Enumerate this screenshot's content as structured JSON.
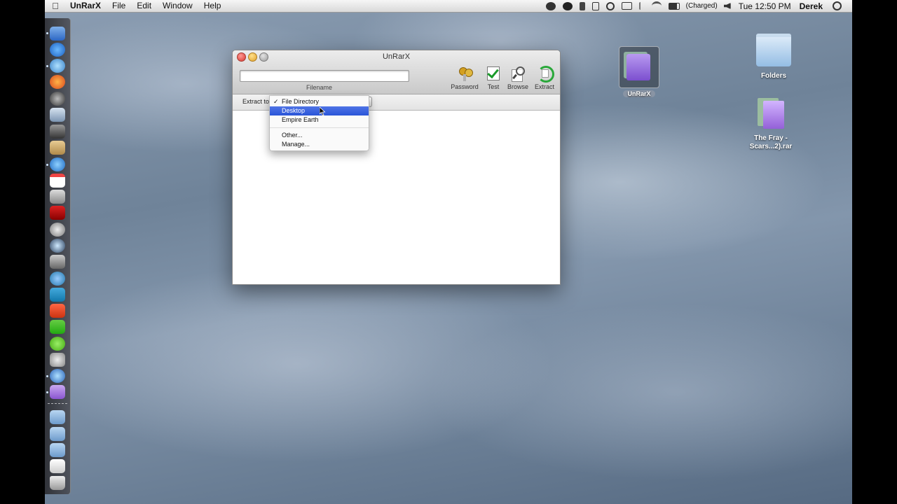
{
  "menubar": {
    "app_name": "UnRarX",
    "menus": [
      "File",
      "Edit",
      "Window",
      "Help"
    ],
    "battery_status": "(Charged)",
    "clock": "Tue 12:50 PM",
    "user": "Derek"
  },
  "window": {
    "title": "UnRarX",
    "filename_value": "",
    "filename_label": "Filename",
    "toolbar": [
      {
        "label": "Password",
        "icon": "keys-icon"
      },
      {
        "label": "Test",
        "icon": "checkbox-icon"
      },
      {
        "label": "Browse",
        "icon": "magnifier-icon"
      },
      {
        "label": "Extract",
        "icon": "extract-arrows-icon"
      }
    ],
    "extract_to_label": "Extract to"
  },
  "dropdown": {
    "items": [
      {
        "label": "File Directory",
        "checked": true,
        "check_mark": "✓"
      },
      {
        "label": "Desktop",
        "highlighted": true
      },
      {
        "label": "Empire Earth"
      },
      {
        "label": "Other..."
      },
      {
        "label": "Manage..."
      }
    ]
  },
  "desktop_icons": [
    {
      "label": "UnRarX"
    },
    {
      "label": "Folders"
    },
    {
      "label_line1": "The Fray -",
      "label_line2": "Scars...2).rar"
    }
  ],
  "colors": {
    "selection": "#2a55d8",
    "close_button": "#e0443e",
    "minimize_button": "#e6a82d",
    "zoom_button": "#9b9b9b"
  }
}
